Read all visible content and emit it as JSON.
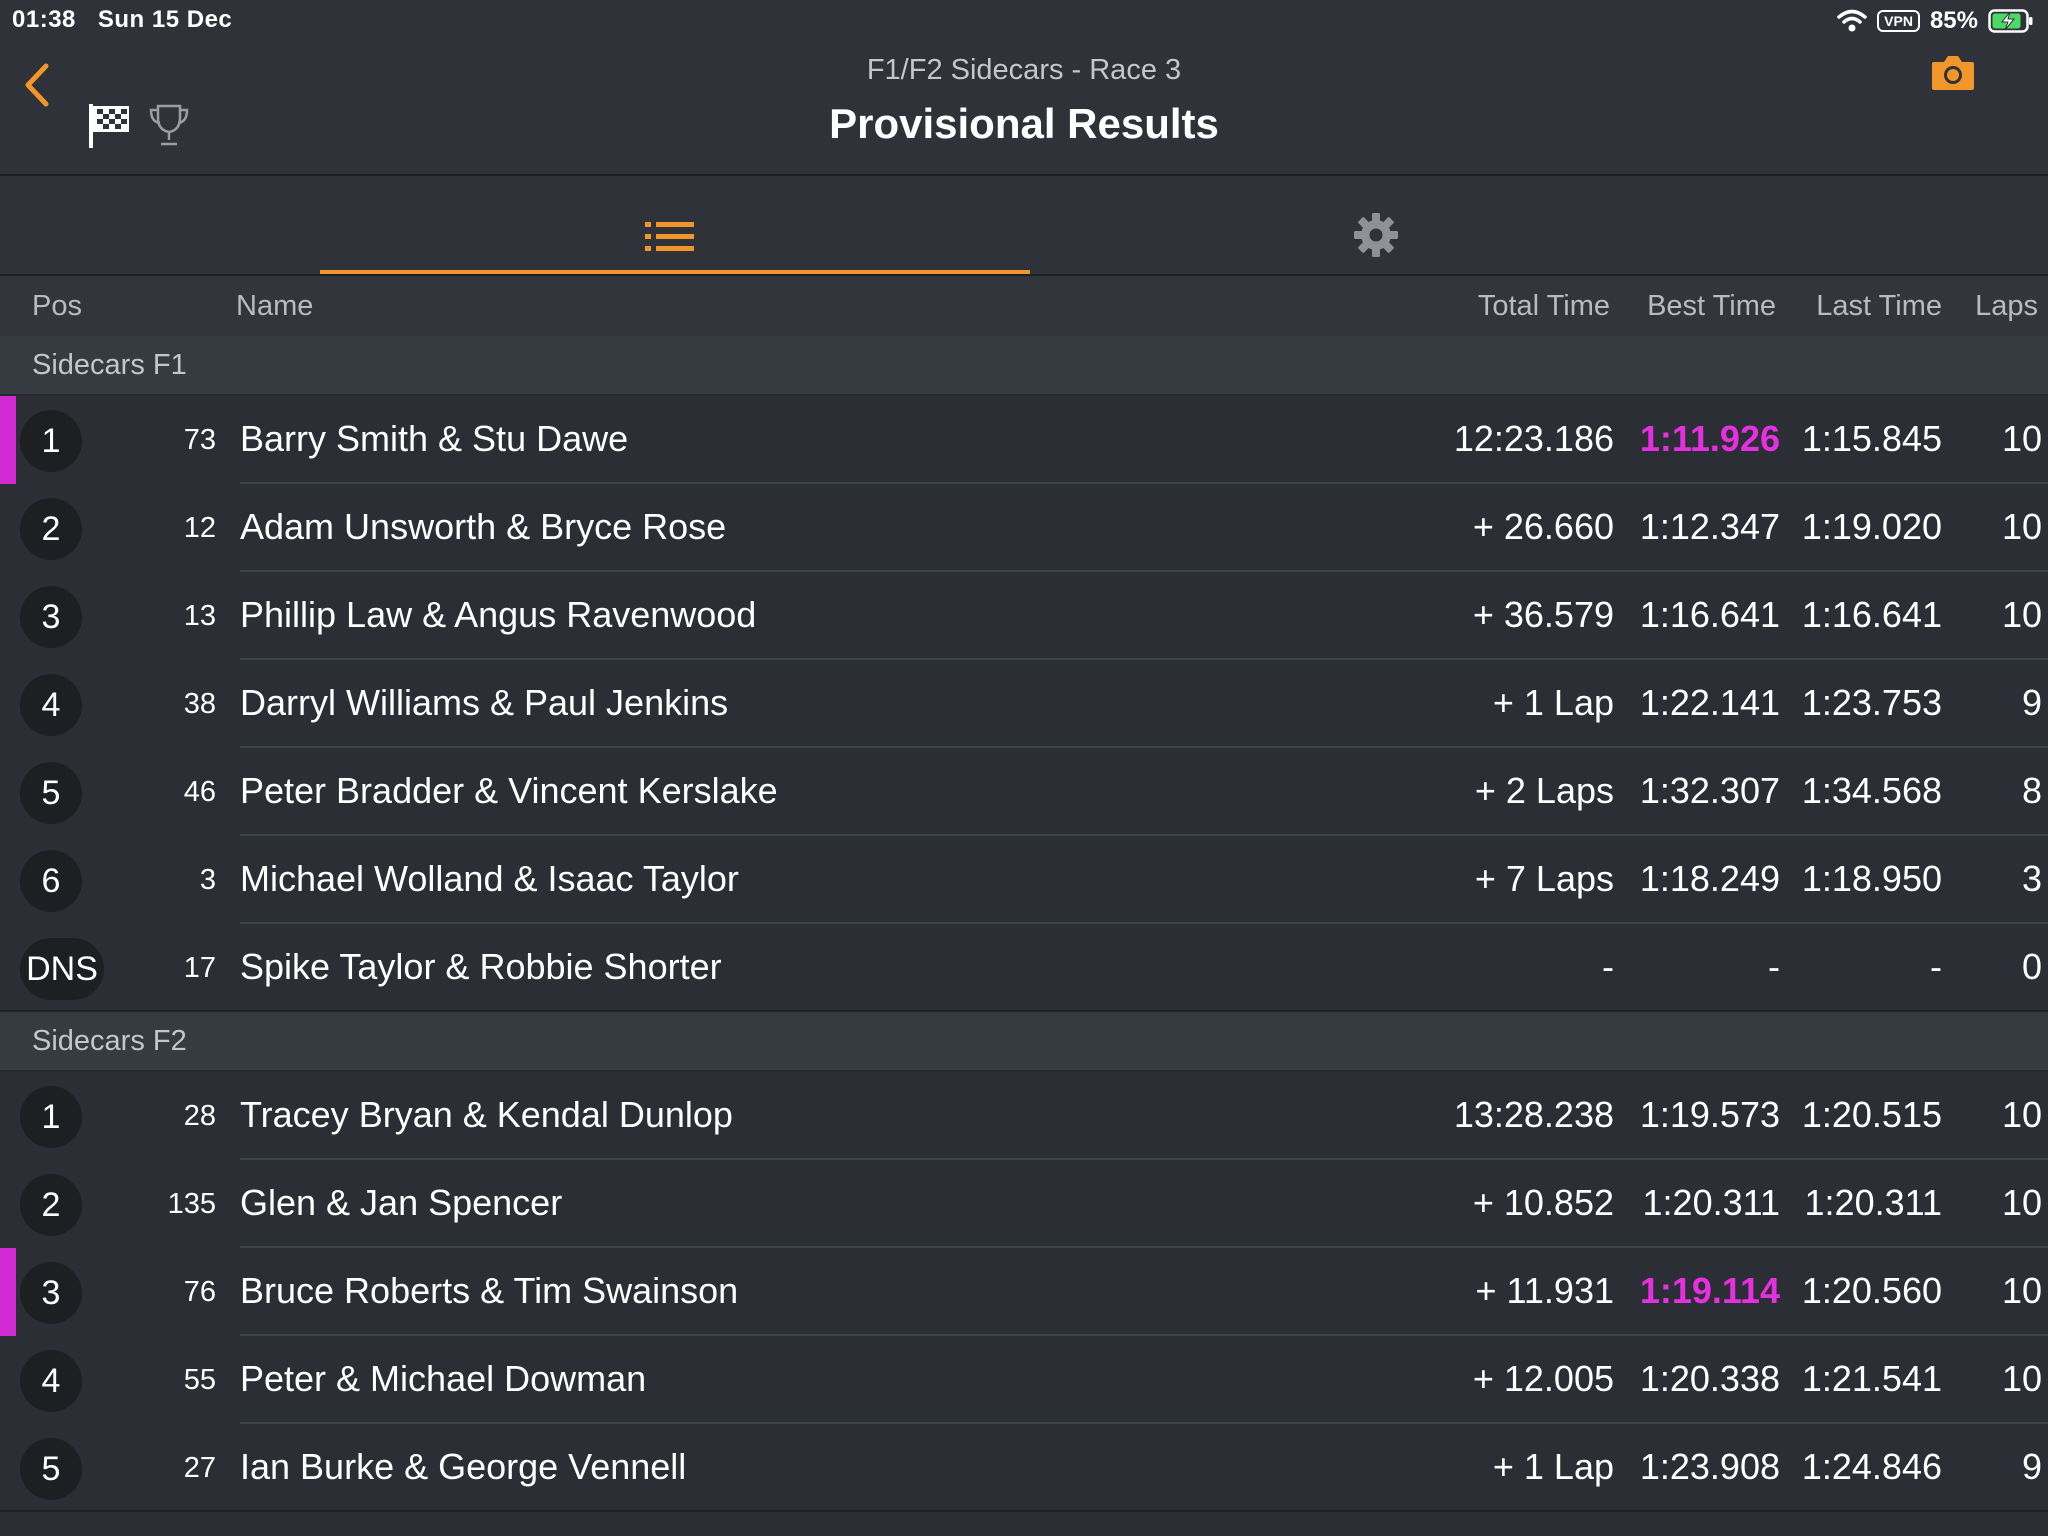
{
  "status": {
    "time": "01:38",
    "date": "Sun 15 Dec",
    "vpn": "VPN",
    "battery": "85%"
  },
  "header": {
    "subtitle": "F1/F2 Sidecars - Race 3",
    "title": "Provisional Results"
  },
  "icons": {
    "back": "chevron-left-icon",
    "flag": "checkered-flag-icon",
    "trophy": "trophy-icon",
    "camera": "camera-icon",
    "list": "list-icon",
    "settings": "gear-icon"
  },
  "colors": {
    "accent": "#f0962b",
    "fastest": "#e62fe0",
    "background": "#2b2e34"
  },
  "columns": {
    "pos": "Pos",
    "name": "Name",
    "total": "Total Time",
    "best": "Best Time",
    "last": "Last Time",
    "laps": "Laps"
  },
  "groups": [
    {
      "name": "Sidecars F1",
      "rows": [
        {
          "pos": "1",
          "num": "73",
          "name": "Barry Smith & Stu Dawe",
          "total": "12:23.186",
          "best": "1:11.926",
          "last": "1:15.845",
          "laps": "10",
          "fastest": true
        },
        {
          "pos": "2",
          "num": "12",
          "name": "Adam Unsworth & Bryce Rose",
          "total": "+ 26.660",
          "best": "1:12.347",
          "last": "1:19.020",
          "laps": "10",
          "fastest": false
        },
        {
          "pos": "3",
          "num": "13",
          "name": "Phillip Law & Angus Ravenwood",
          "total": "+ 36.579",
          "best": "1:16.641",
          "last": "1:16.641",
          "laps": "10",
          "fastest": false
        },
        {
          "pos": "4",
          "num": "38",
          "name": "Darryl Williams & Paul Jenkins",
          "total": "+ 1 Lap",
          "best": "1:22.141",
          "last": "1:23.753",
          "laps": "9",
          "fastest": false
        },
        {
          "pos": "5",
          "num": "46",
          "name": "Peter Bradder & Vincent Kerslake",
          "total": "+ 2 Laps",
          "best": "1:32.307",
          "last": "1:34.568",
          "laps": "8",
          "fastest": false
        },
        {
          "pos": "6",
          "num": "3",
          "name": "Michael Wolland & Isaac Taylor",
          "total": "+ 7 Laps",
          "best": "1:18.249",
          "last": "1:18.950",
          "laps": "3",
          "fastest": false
        },
        {
          "pos": "DNS",
          "num": "17",
          "name": "Spike Taylor & Robbie Shorter",
          "total": "-",
          "best": "-",
          "last": "-",
          "laps": "0",
          "fastest": false
        }
      ]
    },
    {
      "name": "Sidecars F2",
      "rows": [
        {
          "pos": "1",
          "num": "28",
          "name": "Tracey Bryan & Kendal Dunlop",
          "total": "13:28.238",
          "best": "1:19.573",
          "last": "1:20.515",
          "laps": "10",
          "fastest": false
        },
        {
          "pos": "2",
          "num": "135",
          "name": "Glen & Jan Spencer",
          "total": "+ 10.852",
          "best": "1:20.311",
          "last": "1:20.311",
          "laps": "10",
          "fastest": false
        },
        {
          "pos": "3",
          "num": "76",
          "name": "Bruce Roberts & Tim Swainson",
          "total": "+ 11.931",
          "best": "1:19.114",
          "last": "1:20.560",
          "laps": "10",
          "fastest": true
        },
        {
          "pos": "4",
          "num": "55",
          "name": "Peter & Michael Dowman",
          "total": "+ 12.005",
          "best": "1:20.338",
          "last": "1:21.541",
          "laps": "10",
          "fastest": false
        },
        {
          "pos": "5",
          "num": "27",
          "name": "Ian Burke & George Vennell",
          "total": "+ 1 Lap",
          "best": "1:23.908",
          "last": "1:24.846",
          "laps": "9",
          "fastest": false
        }
      ]
    }
  ]
}
